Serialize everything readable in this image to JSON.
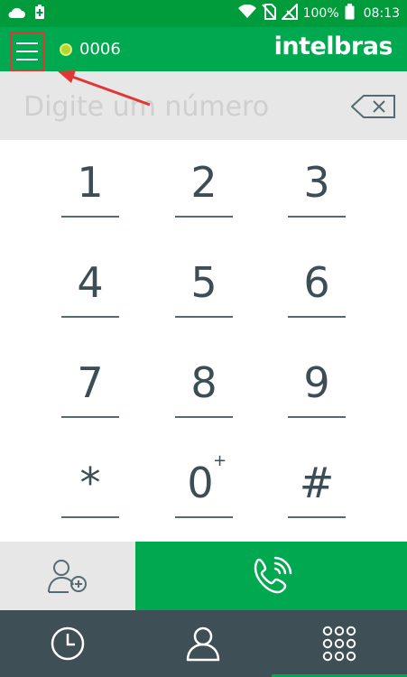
{
  "status_bar": {
    "battery_level": "100%",
    "time": "08:13",
    "icons": [
      "cloud-icon",
      "battery-saver-icon",
      "wifi-icon",
      "no-sim-icon",
      "no-signal-icon",
      "battery-icon"
    ]
  },
  "app_bar": {
    "account_number": "0006",
    "logo_text": "intelbras",
    "status_color": "#b5d630"
  },
  "dialer": {
    "placeholder": "Digite um número"
  },
  "keypad": {
    "keys": [
      "1",
      "2",
      "3",
      "4",
      "5",
      "6",
      "7",
      "8",
      "9",
      "*",
      "0",
      "#"
    ],
    "zero_sub": "+"
  },
  "bottom_nav": {
    "items": [
      "history-icon",
      "contacts-icon",
      "dialpad-icon"
    ],
    "active_index": 2
  },
  "colors": {
    "accent_green": "#00a94f",
    "dark_slate": "#3f4f56",
    "annotation_red": "#e23636"
  }
}
